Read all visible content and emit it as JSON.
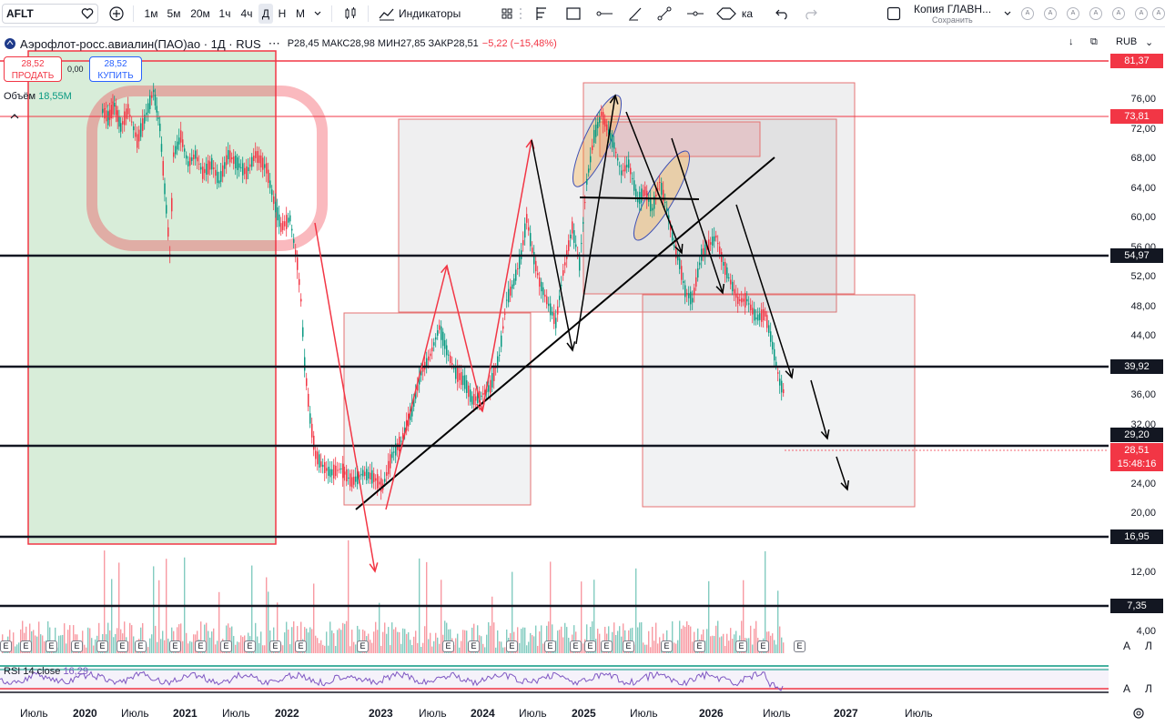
{
  "toolbar": {
    "symbol": "AFLT",
    "timeframes": [
      "1м",
      "5м",
      "20м",
      "1ч",
      "4ч",
      "Д",
      "Н",
      "М"
    ],
    "active_timeframe": "Д",
    "indicators_label": "Индикаторы",
    "alert_label": "ка",
    "layout_name": "Копия ГЛАВН...",
    "layout_status": "Сохранить",
    "right_buttons": [
      "A",
      "A",
      "A",
      "A",
      "A",
      "A",
      "A"
    ]
  },
  "legend": {
    "title": "Аэрофлот-росс.авиалин(ПАО)ао · 1Д · RUS",
    "ohlc_text": "Р28,45  МАКС28,98  МИН27,85  ЗАКР28,51",
    "change": "−5,22 (−15,48%)"
  },
  "trade": {
    "sell_price": "28,52",
    "sell_label": "ПРОДАТЬ",
    "spread": "0,00",
    "buy_price": "28,52",
    "buy_label": "КУПИТЬ"
  },
  "volume": {
    "label": "Объём",
    "value": "18,55M"
  },
  "currency": "RUB",
  "price_axis": [
    "76,00",
    "72,00",
    "68,00",
    "64,00",
    "60,00",
    "56,00",
    "52,00",
    "48,00",
    "44,00",
    "36,00",
    "32,00",
    "24,00",
    "20,00",
    "12,00",
    "4,00"
  ],
  "price_tags": [
    {
      "value": "81,37",
      "color": "#f23645"
    },
    {
      "value": "73,81",
      "color": "#f23645"
    },
    {
      "value": "54,97",
      "color": "#131722"
    },
    {
      "value": "39,92",
      "color": "#131722"
    },
    {
      "value": "29,20",
      "color": "#131722"
    },
    {
      "value": "28,51",
      "color": "#f23645"
    },
    {
      "value": "15:48:16",
      "color": "#f23645"
    },
    {
      "value": "16,95",
      "color": "#131722"
    },
    {
      "value": "7,35",
      "color": "#131722"
    }
  ],
  "time_axis": [
    {
      "label": "Июль",
      "bold": false
    },
    {
      "label": "2020",
      "bold": true
    },
    {
      "label": "Июль",
      "bold": false
    },
    {
      "label": "2021",
      "bold": true
    },
    {
      "label": "Июль",
      "bold": false
    },
    {
      "label": "2022",
      "bold": true
    },
    {
      "label": "2023",
      "bold": true
    },
    {
      "label": "Июль",
      "bold": false
    },
    {
      "label": "2024",
      "bold": true
    },
    {
      "label": "Июль",
      "bold": false
    },
    {
      "label": "2025",
      "bold": true
    },
    {
      "label": "Июль",
      "bold": false
    },
    {
      "label": "2026",
      "bold": true
    },
    {
      "label": "Июль",
      "bold": false
    },
    {
      "label": "2027",
      "bold": true
    },
    {
      "label": "Июль",
      "bold": false
    }
  ],
  "rsi": {
    "label": "RSI 14 close",
    "value": "16,29"
  },
  "event_badge": "E",
  "scale_buttons": [
    "А",
    "Л"
  ],
  "colors": {
    "up": "#089981",
    "down": "#f23645",
    "accent": "#2962ff",
    "rsi": "#7e57c2"
  }
}
